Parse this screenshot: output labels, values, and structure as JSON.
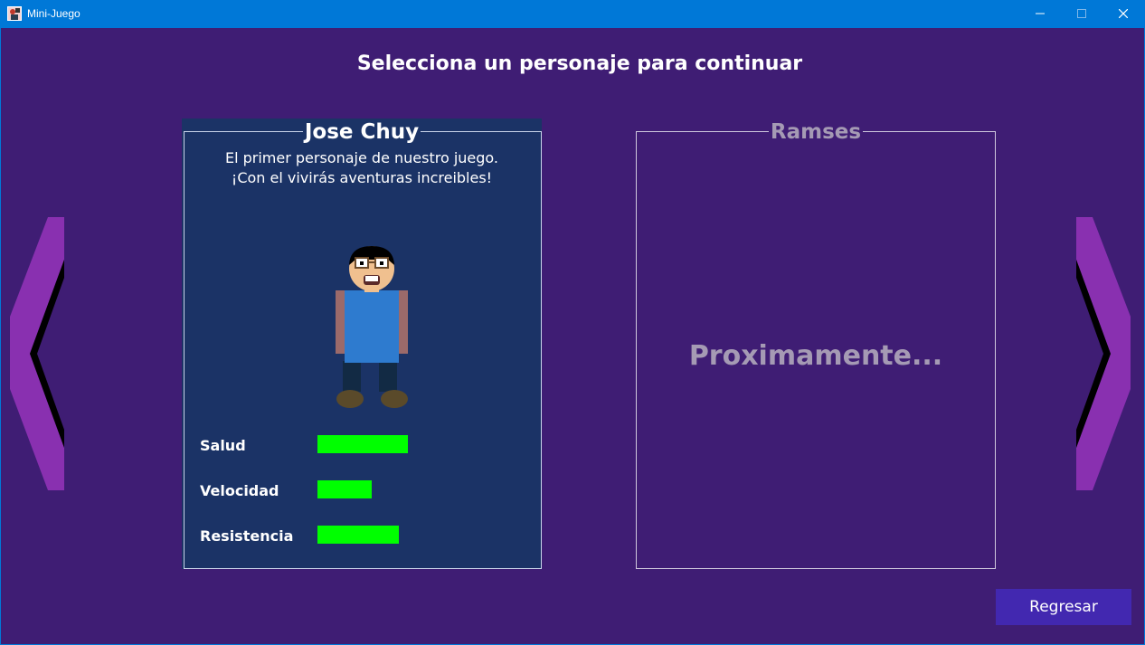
{
  "window": {
    "title": "Mini-Juego",
    "controls": [
      "minimize-icon",
      "maximize-icon",
      "close-icon"
    ]
  },
  "heading": "Selecciona un personaje para continuar",
  "nav": {
    "prev_icon": "chevron-left-icon",
    "next_icon": "chevron-right-icon",
    "arrow_color": "#8930b0"
  },
  "characters": [
    {
      "name": "Jose Chuy",
      "description_line1": "El primer personaje de nuestro juego.",
      "description_line2": "¡Con el vivirás aventuras increibles!",
      "stats": [
        {
          "label": "Salud",
          "value": 1.0
        },
        {
          "label": "Velocidad",
          "value": 0.6
        },
        {
          "label": "Resistencia",
          "value": 0.9
        }
      ]
    },
    {
      "name": "Ramses",
      "status": "Proximamente..."
    }
  ],
  "back_button": "Regresar",
  "colors": {
    "background": "#3f1d74",
    "card": "#1b3366",
    "stat_bar": "#00ff00",
    "button": "#4228b0",
    "titlebar": "#0078d7"
  }
}
